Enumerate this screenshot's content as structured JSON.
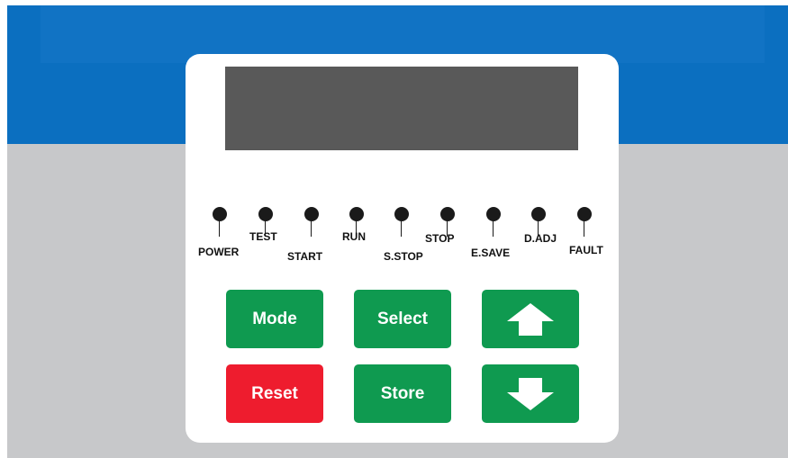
{
  "keypad": {
    "display": {
      "text": ""
    },
    "indicators": [
      {
        "label": "POWER"
      },
      {
        "label": "TEST"
      },
      {
        "label": "START"
      },
      {
        "label": "RUN"
      },
      {
        "label": "S.STOP"
      },
      {
        "label": "STOP"
      },
      {
        "label": "E.SAVE"
      },
      {
        "label": "D.ADJ"
      },
      {
        "label": "FAULT"
      }
    ],
    "buttons": {
      "mode": "Mode",
      "select": "Select",
      "up_icon": "up-arrow-icon",
      "reset": "Reset",
      "store": "Store",
      "down_icon": "down-arrow-icon"
    }
  },
  "colors": {
    "top_band": "#0b6fc0",
    "body": "#c7c8ca",
    "button_green": "#0f9a50",
    "button_red": "#ee1c2e",
    "display": "#595959",
    "led": "#1a1a1a"
  }
}
